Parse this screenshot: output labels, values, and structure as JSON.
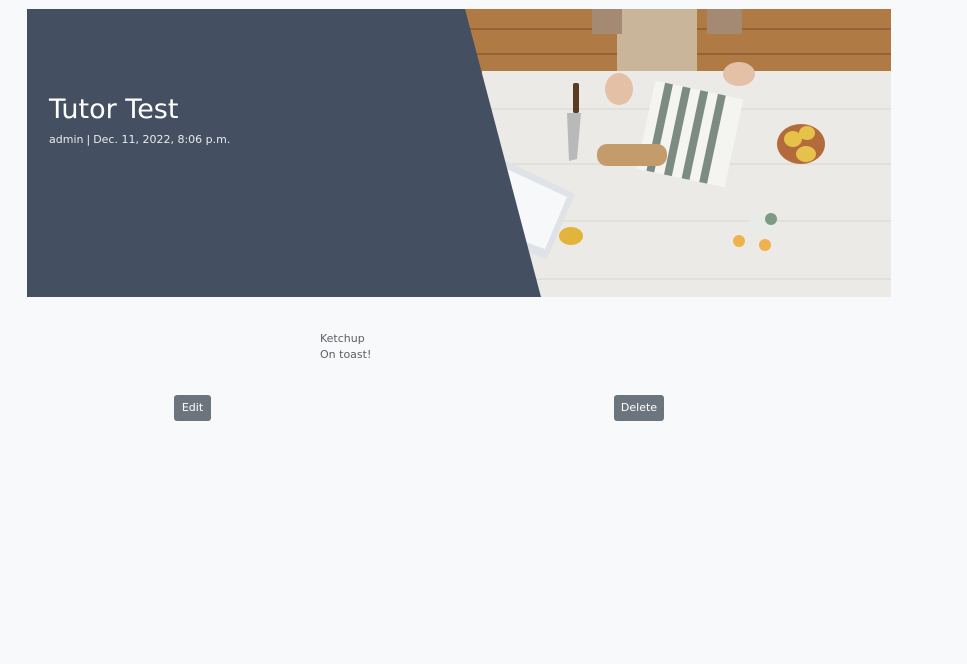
{
  "post": {
    "title": "Tutor Test",
    "author": "admin",
    "separator": "|",
    "date": "Dec. 11, 2022, 8:06 p.m.",
    "content_lines": [
      "Ketchup",
      "On toast!"
    ]
  },
  "actions": {
    "edit_label": "Edit",
    "delete_label": "Delete"
  },
  "colors": {
    "hero_panel": "#445062",
    "button_bg": "#6c757d",
    "page_bg": "#f8f9fa"
  }
}
